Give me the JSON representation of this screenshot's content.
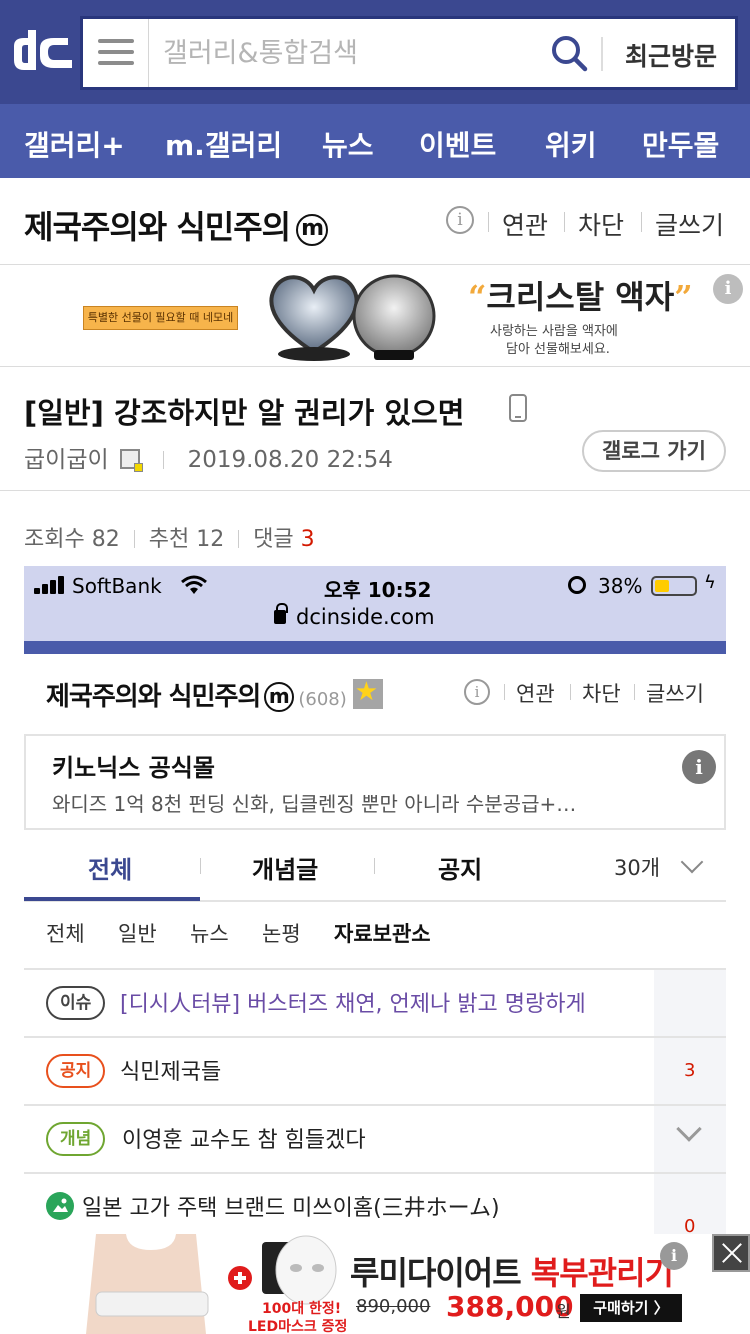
{
  "header": {
    "search_placeholder": "갤러리&통합검색",
    "recent_label": "최근방문"
  },
  "nav": {
    "items": [
      "갤러리+",
      "m.갤러리",
      "뉴스",
      "이벤트",
      "위키",
      "만두몰"
    ]
  },
  "gallery": {
    "name": "제국주의와 식민주의",
    "badge": "m",
    "actions": [
      "연관",
      "차단",
      "글쓰기"
    ]
  },
  "ad_top": {
    "tag": "특별한 선물이 필요할 때 네모네",
    "title": "크리스탈 액자",
    "desc1": "사랑하는 사람을 액자에",
    "desc2": "담아 선물해보세요.",
    "info": "i"
  },
  "post": {
    "title": "[일반] 강조하지만 알 권리가 있으면",
    "author": "굽이굽이",
    "datetime": "2019.08.20 22:54",
    "gallog_button": "갤로그 가기",
    "views_label": "조회수 82",
    "recommend_label": "추천 12",
    "comments_label": "댓글",
    "comments_count": "3"
  },
  "screenshot": {
    "status": {
      "carrier": "SoftBank",
      "time": "오후 10:52",
      "battery": "38%",
      "battery_level": 0.38,
      "url": "dcinside.com"
    },
    "gallery_name": "제국주의와 식민주의",
    "badge": "m",
    "member_count": "(608)",
    "actions": [
      "연관",
      "차단",
      "글쓰기"
    ],
    "ad": {
      "title": "키노닉스 공식몰",
      "desc": "와디즈 1억 8천 펀딩 신화, 딥클렌징 뿐만 아니라 수분공급+…",
      "info": "i"
    },
    "tabs": [
      "전체",
      "개념글",
      "공지"
    ],
    "per_page": "30개",
    "subtabs": [
      "전체",
      "일반",
      "뉴스",
      "논평",
      "자료보관소"
    ],
    "rows": [
      {
        "tag": "이슈",
        "text": "[디시人터뷰] 버스터즈 채연, 언제나 밝고 명랑하게",
        "count": ""
      },
      {
        "tag": "공지",
        "text": "식민제국들",
        "count": "3"
      },
      {
        "tag": "개념",
        "text": "이영훈 교수도 참 힘들겠다",
        "count": ""
      },
      {
        "tag": "",
        "text": "일본 고가 주택 브랜드 미쓰이홈(三井ホーム)",
        "count": "0"
      }
    ]
  },
  "ad_bottom": {
    "title_black": "루미다이어트",
    "title_red": "복부관리기",
    "old_price": "890,000",
    "new_price": "388,000",
    "won": "원",
    "buy": "구매하기 〉",
    "promo1": "100대 한정!",
    "promo2": "LED마스크 증정"
  },
  "colors": {
    "header_bg": "#3b4890",
    "nav_bg": "#4a5baa",
    "accent_red": "#d31900",
    "issue_purple": "#6a4ca6",
    "notice_orange": "#e8501d",
    "concept_green": "#6fa631"
  }
}
